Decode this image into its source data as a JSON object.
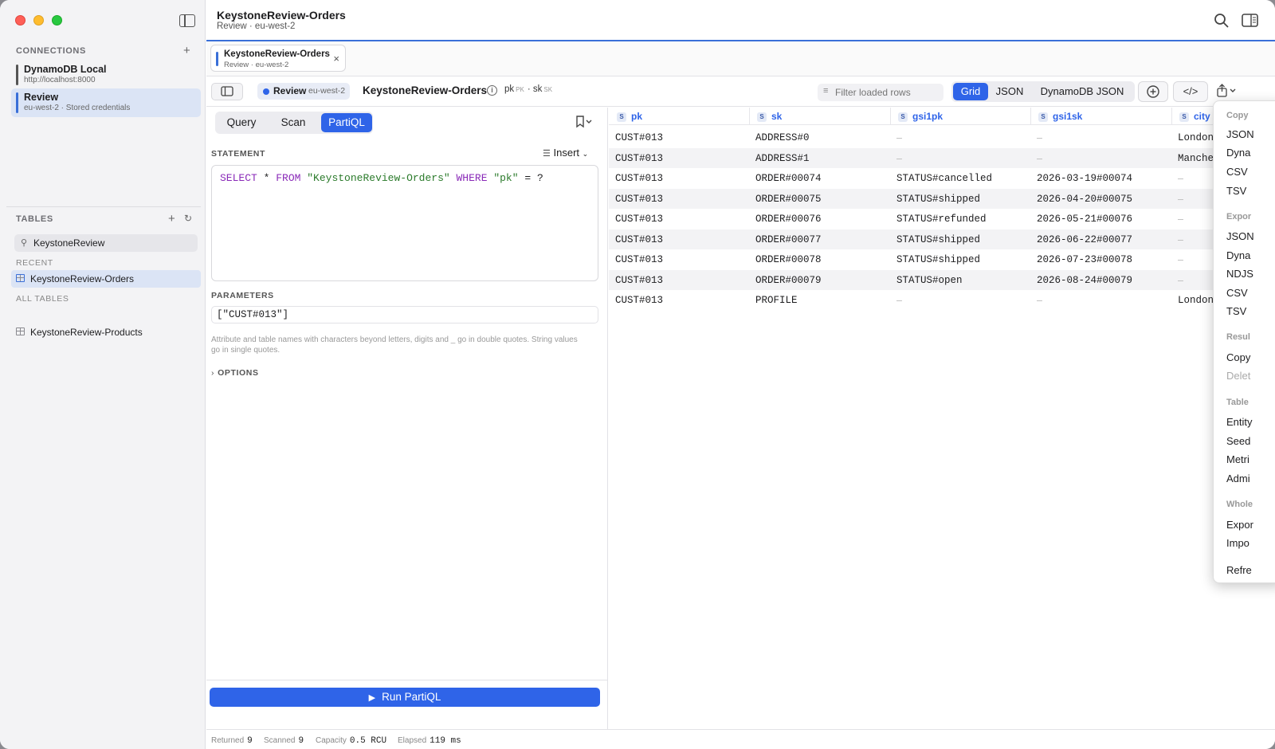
{
  "window": {
    "title": "KeystoneReview-Orders",
    "subtitle": "Review · eu-west-2"
  },
  "sidebar": {
    "connections_header": "CONNECTIONS",
    "connections": [
      {
        "name": "DynamoDB Local",
        "sub": "http://localhost:8000",
        "color": "#555555",
        "active": false
      },
      {
        "name": "Review",
        "sub": "eu-west-2 · Stored credentials",
        "color": "#3a6fd8",
        "active": true
      }
    ],
    "tables_header": "TABLES",
    "search_value": "KeystoneReview",
    "recent_header": "RECENT",
    "recent": [
      "KeystoneReview-Orders"
    ],
    "all_header": "ALL TABLES",
    "all": [
      "KeystoneReview-Products"
    ]
  },
  "tab": {
    "name": "KeystoneReview-Orders",
    "sub": "Review · eu-west-2",
    "close": "×"
  },
  "toolbar": {
    "env": "Review",
    "region": "eu-west-2",
    "table": "KeystoneReview-Orders",
    "pk": "pk",
    "pk_tag": "PK",
    "sk": "sk",
    "sk_tag": "SK",
    "filter_placeholder": "Filter loaded rows",
    "views": [
      "Grid",
      "JSON",
      "DynamoDB JSON"
    ],
    "active_view": "Grid",
    "accent": "#2f64e8"
  },
  "editor": {
    "modes": [
      "Query",
      "Scan",
      "PartiQL"
    ],
    "active_mode": "PartiQL",
    "statement_label": "STATEMENT",
    "insert_label": "Insert",
    "statement": {
      "kw1": "SELECT",
      "star": " * ",
      "kw2": "FROM",
      "table": "\"KeystoneReview-Orders\"",
      "kw3": "WHERE",
      "attr": "\"pk\"",
      "rest": " = ?"
    },
    "parameters_label": "PARAMETERS",
    "parameters": "[\"CUST#013\"]",
    "hint": "Attribute and table names with characters beyond letters, digits and _ go in double quotes. String values go in single quotes.",
    "options_label": "OPTIONS",
    "run_label": "Run PartiQL"
  },
  "grid": {
    "columns": [
      {
        "type": "S",
        "name": "pk"
      },
      {
        "type": "S",
        "name": "sk"
      },
      {
        "type": "S",
        "name": "gsi1pk"
      },
      {
        "type": "S",
        "name": "gsi1sk"
      },
      {
        "type": "S",
        "name": "city"
      }
    ],
    "rows": [
      [
        "CUST#013",
        "ADDRESS#0",
        "–",
        "–",
        "London"
      ],
      [
        "CUST#013",
        "ADDRESS#1",
        "–",
        "–",
        "Manche"
      ],
      [
        "CUST#013",
        "ORDER#00074",
        "STATUS#cancelled",
        "2026-03-19#00074",
        "–"
      ],
      [
        "CUST#013",
        "ORDER#00075",
        "STATUS#shipped",
        "2026-04-20#00075",
        "–"
      ],
      [
        "CUST#013",
        "ORDER#00076",
        "STATUS#refunded",
        "2026-05-21#00076",
        "–"
      ],
      [
        "CUST#013",
        "ORDER#00077",
        "STATUS#shipped",
        "2026-06-22#00077",
        "–"
      ],
      [
        "CUST#013",
        "ORDER#00078",
        "STATUS#shipped",
        "2026-07-23#00078",
        "–"
      ],
      [
        "CUST#013",
        "ORDER#00079",
        "STATUS#open",
        "2026-08-24#00079",
        "–"
      ],
      [
        "CUST#013",
        "PROFILE",
        "–",
        "–",
        "London"
      ]
    ]
  },
  "status": {
    "returned_label": "Returned",
    "returned": "9",
    "scanned_label": "Scanned",
    "scanned": "9",
    "capacity_label": "Capacity",
    "capacity": "0.5 RCU",
    "elapsed_label": "Elapsed",
    "elapsed": "119 ms"
  },
  "menu": {
    "items": [
      {
        "t": "h",
        "label": "Copy"
      },
      {
        "t": "i",
        "label": "JSON"
      },
      {
        "t": "i",
        "label": "Dyna"
      },
      {
        "t": "i",
        "label": "CSV"
      },
      {
        "t": "i",
        "label": "TSV"
      },
      {
        "t": "h",
        "label": "Expor"
      },
      {
        "t": "i",
        "label": "JSON"
      },
      {
        "t": "i",
        "label": "Dyna"
      },
      {
        "t": "i",
        "label": "NDJS"
      },
      {
        "t": "i",
        "label": "CSV"
      },
      {
        "t": "i",
        "label": "TSV"
      },
      {
        "t": "h",
        "label": "Resul"
      },
      {
        "t": "i",
        "label": "Copy"
      },
      {
        "t": "d",
        "label": "Delet"
      },
      {
        "t": "h",
        "label": "Table"
      },
      {
        "t": "i",
        "label": "Entity"
      },
      {
        "t": "i",
        "label": "Seed"
      },
      {
        "t": "i",
        "label": "Metri"
      },
      {
        "t": "i",
        "label": "Admi"
      },
      {
        "t": "h",
        "label": "Whole"
      },
      {
        "t": "i",
        "label": "Expor"
      },
      {
        "t": "i",
        "label": "Impo"
      },
      {
        "t": "i",
        "label": "Refre"
      }
    ]
  }
}
